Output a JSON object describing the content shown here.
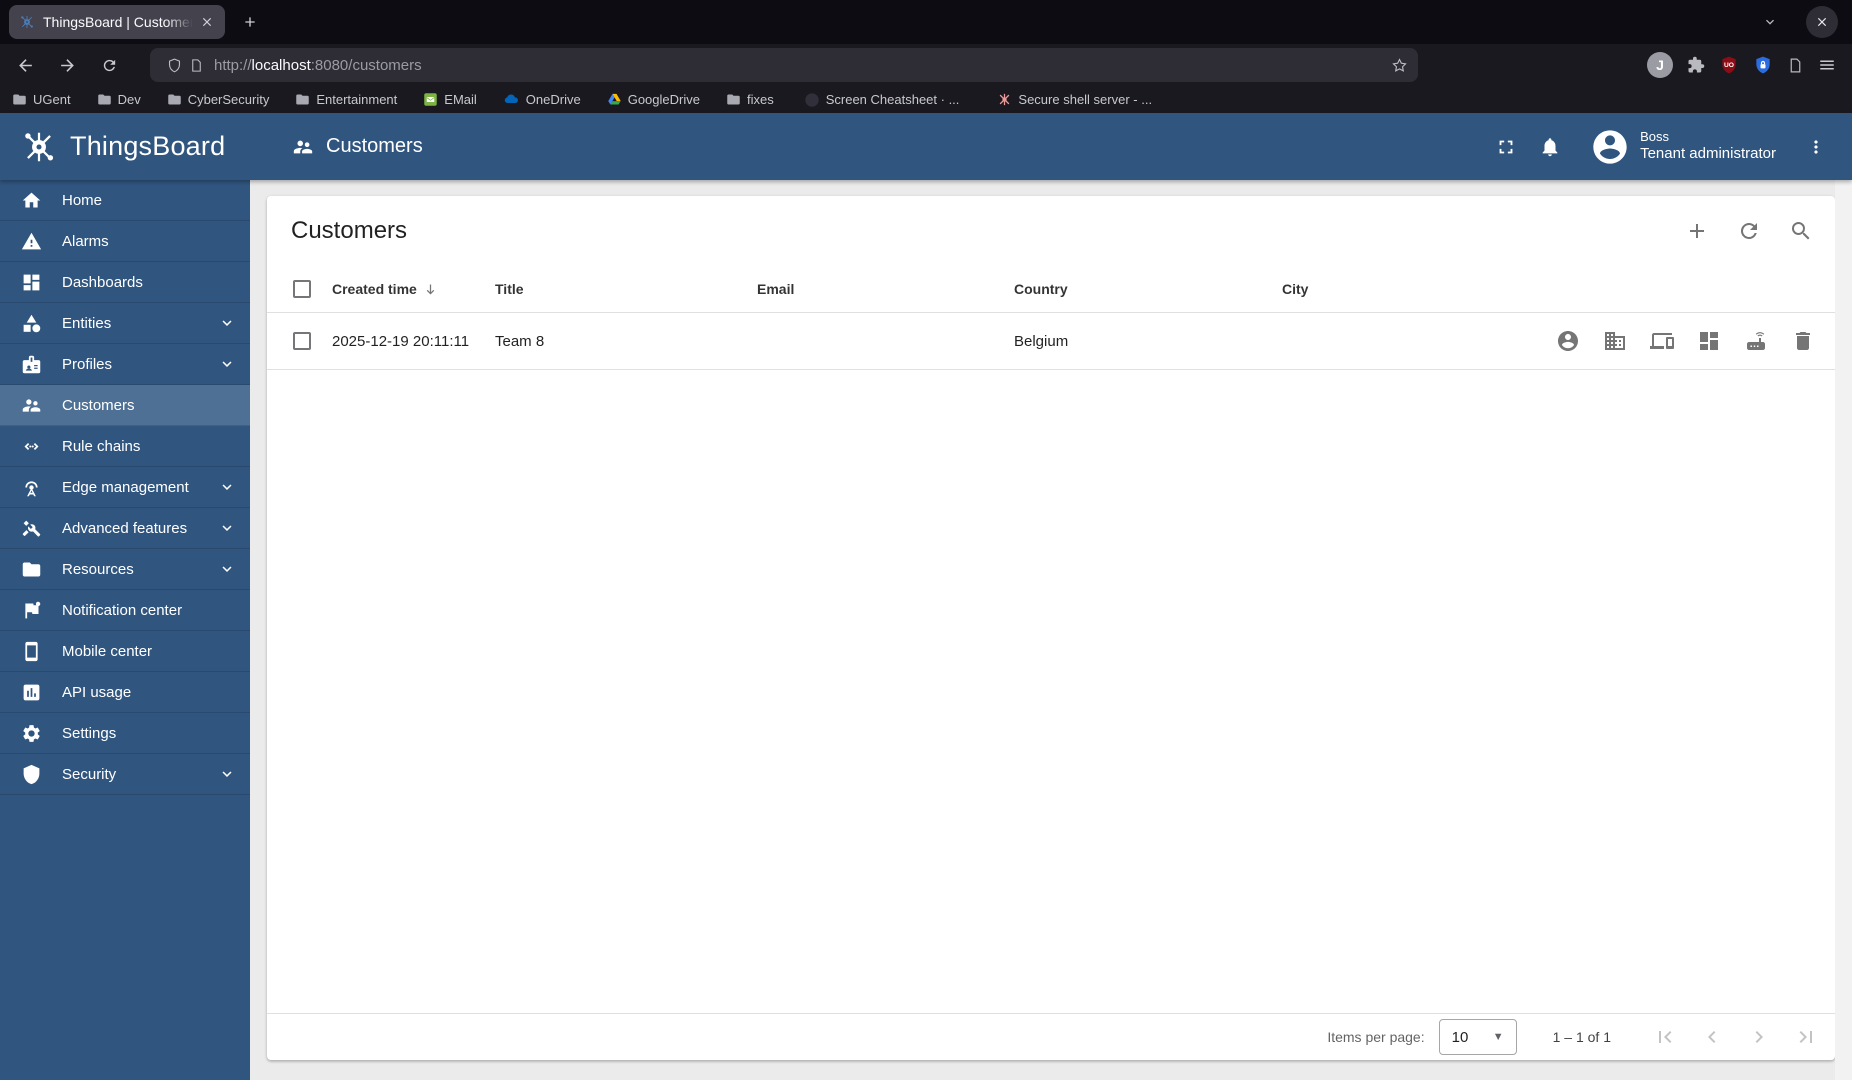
{
  "browser": {
    "tab_title": "ThingsBoard | Customer",
    "url_scheme": "http://",
    "url_host": "localhost",
    "url_path": ":8080/customers",
    "profile_initial": "J",
    "ublock_label": "uO",
    "bookmarks": [
      {
        "label": "UGent",
        "icon": "folder"
      },
      {
        "label": "Dev",
        "icon": "folder"
      },
      {
        "label": "CyberSecurity",
        "icon": "folder"
      },
      {
        "label": "Entertainment",
        "icon": "folder"
      },
      {
        "label": "EMail",
        "icon": "email"
      },
      {
        "label": "OneDrive",
        "icon": "onedrive-cloud"
      },
      {
        "label": "GoogleDrive",
        "icon": "google-drive"
      },
      {
        "label": "fixes",
        "icon": "folder"
      },
      {
        "label": "Screen Cheatsheet · ...",
        "icon": "github"
      },
      {
        "label": "Secure shell server - ...",
        "icon": "thingsboard"
      }
    ]
  },
  "app_header": {
    "brand": "ThingsBoard",
    "page_title": "Customers",
    "user": {
      "name": "Boss",
      "role": "Tenant administrator"
    }
  },
  "sidebar": {
    "items": [
      {
        "label": "Home",
        "icon": "home",
        "expandable": false,
        "active": false
      },
      {
        "label": "Alarms",
        "icon": "warning",
        "expandable": false,
        "active": false
      },
      {
        "label": "Dashboards",
        "icon": "dashboard",
        "expandable": false,
        "active": false
      },
      {
        "label": "Entities",
        "icon": "category",
        "expandable": true,
        "active": false
      },
      {
        "label": "Profiles",
        "icon": "badge",
        "expandable": true,
        "active": false
      },
      {
        "label": "Customers",
        "icon": "people",
        "expandable": false,
        "active": true
      },
      {
        "label": "Rule chains",
        "icon": "rule-chain",
        "expandable": false,
        "active": false
      },
      {
        "label": "Edge management",
        "icon": "antenna",
        "expandable": true,
        "active": false
      },
      {
        "label": "Advanced features",
        "icon": "tools",
        "expandable": true,
        "active": false
      },
      {
        "label": "Resources",
        "icon": "folder",
        "expandable": true,
        "active": false
      },
      {
        "label": "Notification center",
        "icon": "flag",
        "expandable": false,
        "active": false
      },
      {
        "label": "Mobile center",
        "icon": "smartphone",
        "expandable": false,
        "active": false
      },
      {
        "label": "API usage",
        "icon": "chart-box",
        "expandable": false,
        "active": false
      },
      {
        "label": "Settings",
        "icon": "gear",
        "expandable": false,
        "active": false
      },
      {
        "label": "Security",
        "icon": "shield",
        "expandable": true,
        "active": false
      }
    ]
  },
  "main": {
    "title": "Customers",
    "table": {
      "columns": {
        "created_time": "Created time",
        "title": "Title",
        "email": "Email",
        "country": "Country",
        "city": "City"
      },
      "row": {
        "created_time": "2025-12-19 20:11:11",
        "title": "Team 8",
        "email": "",
        "country": "Belgium",
        "city": ""
      },
      "row_actions": [
        "manage-customer-users",
        "manage-assets",
        "manage-devices",
        "manage-dashboards",
        "manage-edges",
        "delete"
      ]
    },
    "pagination": {
      "items_per_page_label": "Items per page:",
      "items_per_page_value": "10",
      "range": "1 – 1 of 1"
    }
  },
  "colors": {
    "primary": "#305680",
    "active_item": "#4f7095",
    "icon_gray": "#757575"
  }
}
